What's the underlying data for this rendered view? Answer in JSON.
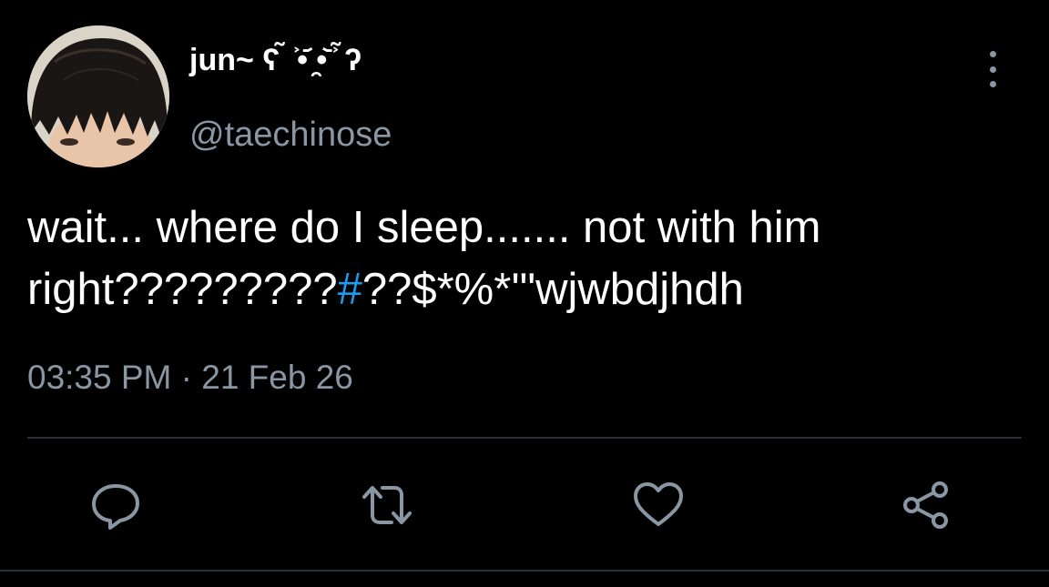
{
  "user": {
    "display_name": "jun~ ʕ ̃ ͐•᷄ ̯•᷅ ͐ ̃ʔ",
    "handle": "@taechinose"
  },
  "tweet": {
    "line1": "wait... where do I sleep....... not with him",
    "line2_before": "right?????????",
    "line2_hashtag": "#",
    "line2_after": "??$*%*'\"wjwbdjhdh",
    "timestamp": "03:35 PM · 21 Feb 26"
  },
  "icons": {
    "more": "more-vertical-icon",
    "reply": "reply-icon",
    "retweet": "retweet-icon",
    "like": "heart-icon",
    "share": "share-icon"
  },
  "colors": {
    "background": "#000000",
    "text": "#ffffff",
    "secondary": "#8a96a3",
    "hashtag": "#1d9bf0",
    "divider": "#2a2f35"
  }
}
